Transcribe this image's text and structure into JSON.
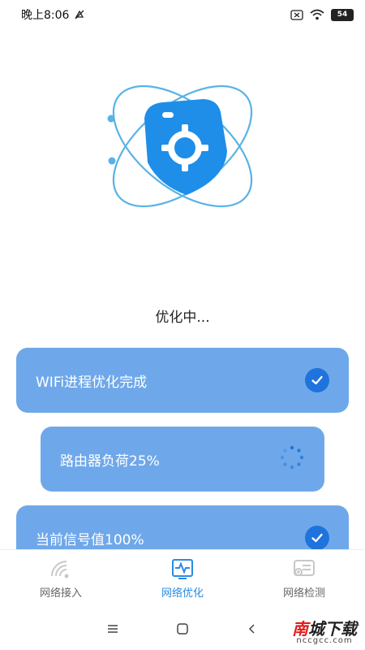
{
  "status_bar": {
    "time": "晚上8:06",
    "battery": "54"
  },
  "main": {
    "status_text": "优化中...",
    "tasks": [
      {
        "label": "WIFi进程优化完成",
        "state": "done"
      },
      {
        "label": "路由器负荷25%",
        "state": "loading"
      },
      {
        "label": "当前信号值100%",
        "state": "done"
      }
    ]
  },
  "bottom_nav": {
    "items": [
      {
        "label": "网络接入",
        "icon": "wifi-signal-icon",
        "active": false
      },
      {
        "label": "网络优化",
        "icon": "optimize-icon",
        "active": true
      },
      {
        "label": "网络检测",
        "icon": "detect-icon",
        "active": false
      }
    ]
  },
  "watermark": {
    "title_a": "南",
    "title_b": "城下载",
    "subtitle": "nccgcc.com"
  },
  "colors": {
    "card": "#6fa8ea",
    "accent": "#2a8be3",
    "check": "#1f73dc"
  }
}
